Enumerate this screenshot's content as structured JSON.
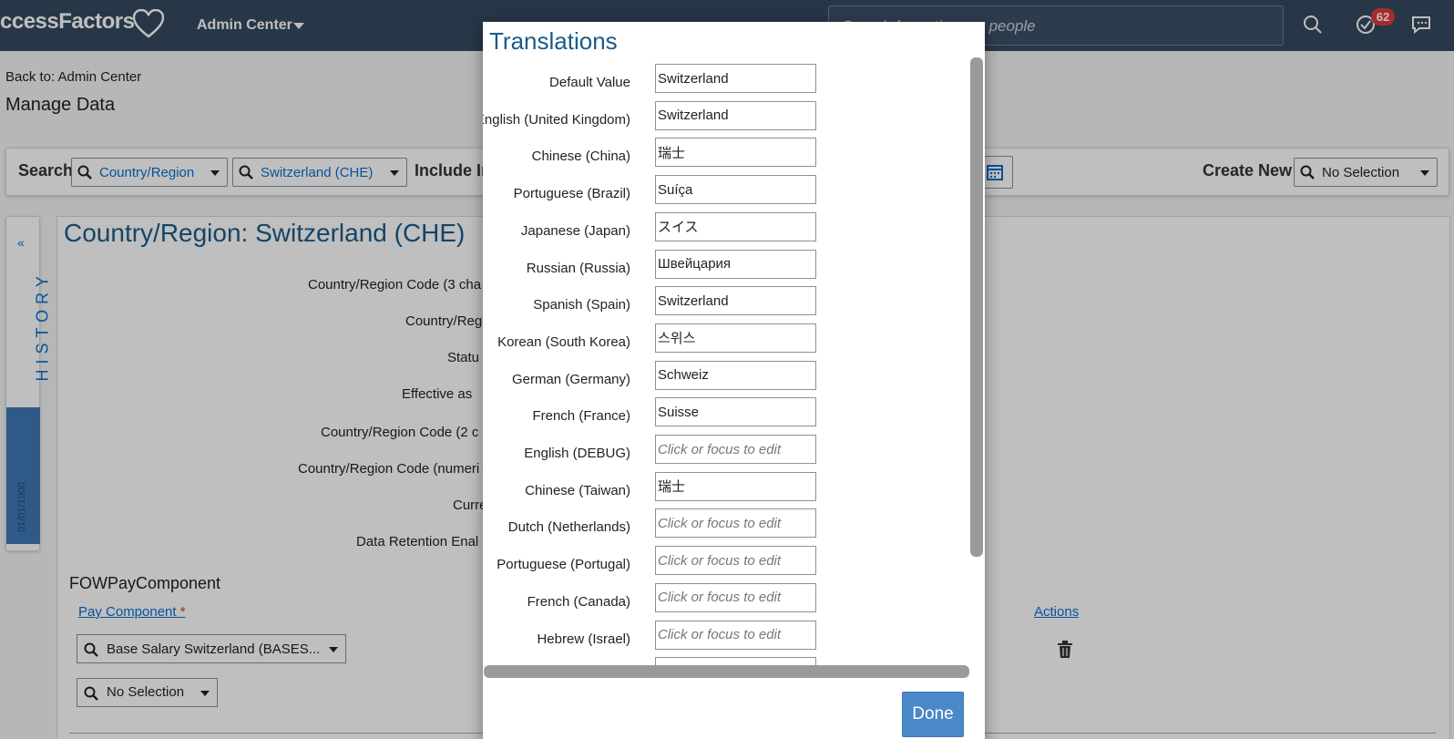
{
  "header": {
    "logo_text": "ccessFactors",
    "admin_menu": "Admin Center",
    "search_placeholder": "Search for actions or people",
    "notification_count": "62",
    "colors": {
      "bar": "#354a5f",
      "badge": "#e03a3a"
    }
  },
  "page": {
    "back_link": "Back to: Admin Center",
    "title": "Manage Data"
  },
  "search_bar": {
    "search_label": "Search",
    "type_value": "Country/Region",
    "record_value": "Switzerland (CHE)",
    "include_label": "Include In",
    "create_new_label": "Create New",
    "create_new_value": "No Selection"
  },
  "history": {
    "label": "HISTORY",
    "date": "01/01/1900"
  },
  "record": {
    "title": "Country/Region: Switzerland (CHE)",
    "fields": [
      "Country/Region Code (3 cha",
      "Country/Reg",
      "Statu",
      "Effective as",
      "Country/Region Code (2 c",
      "Country/Region Code (numeri",
      "Curre",
      "Data Retention Enal"
    ],
    "section": "FOWPayComponent",
    "pay_component_header": "Pay Component",
    "required_mark": "*",
    "actions_header": "Actions",
    "pay_component_value": "Base Salary Switzerland (BASES...",
    "second_selection": "No Selection"
  },
  "dialog": {
    "title": "Translations",
    "done_label": "Done",
    "placeholder": "Click or focus to edit",
    "rows": [
      {
        "label": "Default Value",
        "value": "Switzerland"
      },
      {
        "label": "English (United Kingdom)",
        "value": "Switzerland"
      },
      {
        "label": "Chinese (China)",
        "value": "瑞士"
      },
      {
        "label": "Portuguese (Brazil)",
        "value": "Suíça"
      },
      {
        "label": "Japanese (Japan)",
        "value": "スイス"
      },
      {
        "label": "Russian (Russia)",
        "value": "Швейцария"
      },
      {
        "label": "Spanish (Spain)",
        "value": "Switzerland"
      },
      {
        "label": "Korean (South Korea)",
        "value": "스위스"
      },
      {
        "label": "German (Germany)",
        "value": "Schweiz"
      },
      {
        "label": "French (France)",
        "value": "Suisse"
      },
      {
        "label": "English (DEBUG)",
        "value": ""
      },
      {
        "label": "Chinese (Taiwan)",
        "value": "瑞士"
      },
      {
        "label": "Dutch (Netherlands)",
        "value": ""
      },
      {
        "label": "Portuguese (Portugal)",
        "value": ""
      },
      {
        "label": "French (Canada)",
        "value": ""
      },
      {
        "label": "Hebrew (Israel)",
        "value": ""
      }
    ]
  }
}
